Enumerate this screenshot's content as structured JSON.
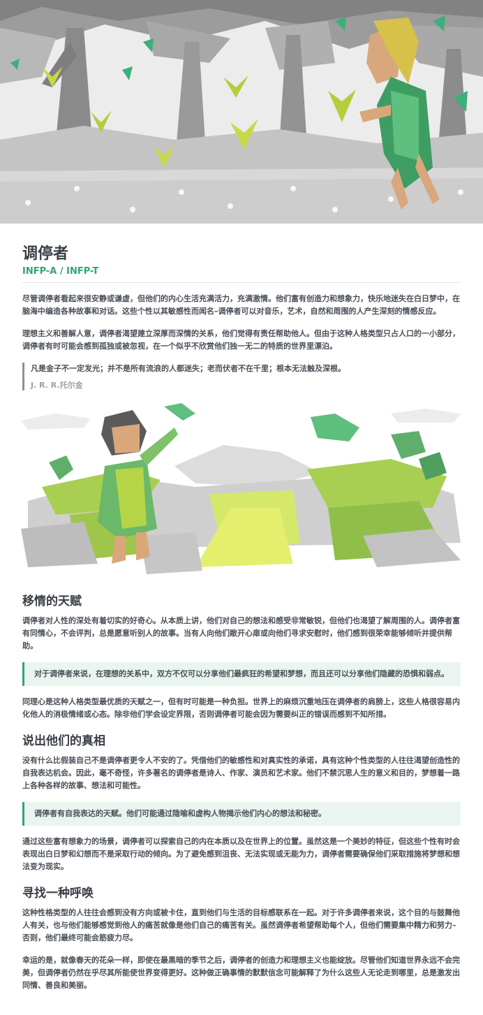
{
  "title": "调停者",
  "subtitle": "INFP-A / INFP-T",
  "intro": [
    "尽管调停者看起来很安静或谦虚，但他们的内心生活充满活力，充满激情。他们富有创造力和想象力，快乐地迷失在白日梦中，在脑海中编造各种故事和对话。这些个性以其敏感性而闻名–调停者可以对音乐，艺术，自然和周围的人产生深刻的情感反应。",
    "理想主义和善解人意，调停者渴望建立深厚而深情的关系，他们觉得有责任帮助他人。但由于这种人格类型只占人口的一小部分，调停者有时可能会感到孤独或被忽视，在一个似乎不欣赏他们独一无二的特质的世界里漂泊。"
  ],
  "quote": {
    "text": "凡是金子不一定发光；并不是所有流浪的人都迷失；老而伏者不在千里；根本无法触及深根。",
    "author": "J. R. R.托尔金"
  },
  "sections": [
    {
      "heading": "移情的天赋",
      "para1": "调停者对人性的深处有着切实的好奇心。从本质上讲，他们对自己的想法和感受非常敏锐，但他们也渴望了解周围的人。调停者富有同情心，不会评判，总是愿意听别人的故事。当有人向他们敞开心扉或向他们寻求安慰时，他们感到很荣幸能够倾听并提供帮助。",
      "callout": "对于调停者来说，在理想的关系中，双方不仅可以分享他们最疯狂的希望和梦想，而且还可以分享他们隐藏的恐惧和弱点。",
      "para2": "同理心是这种人格类型最优质的天赋之一，但有时可能是一种负担。世界上的麻烦沉重地压在调停者的肩膀上，这些人格很容易内化他人的消极情绪或心态。除非他们学会设定界限，否则调停者可能会因为需要纠正的错误而感到不知所措。"
    },
    {
      "heading": "说出他们的真相",
      "para1": "没有什么比假装自己不是调停者更令人不安的了。凭借他们的敏感性和对真实性的承诺，具有这种个性类型的人往往渴望创造性的自我表达机会。因此，毫不奇怪，许多著名的调停者是诗人、作家、演员和艺术家。他们不禁沉思人生的意义和目的，梦想着一路上各种各样的故事、想法和可能性。",
      "callout": "调停者有自我表达的天赋。他们可能通过隐喻和虚构人物揭示他们内心的想法和秘密。",
      "para2": "通过这些富有想象力的场景，调停者可以探索自己的内在本质以及在世界上的位置。虽然这是一个美妙的特征，但这些个性有时会表现出白日梦和幻想而不是采取行动的倾向。为了避免感到沮丧、无法实现或无能为力，调停者需要确保他们采取措施将梦想和想法变为现实。"
    },
    {
      "heading": "寻找一种呼唤",
      "para1": "这种性格类型的人往往会感到没有方向或被卡住，直到他们与生活的目标感联系在一起。对于许多调停者来说，这个目的与鼓舞他人有关，也与他们能够感觉到他人的痛苦就像是他们自己的痛苦有关。虽然调停者希望帮助每个人，但他们需要集中精力和努力–否则，他们最终可能会筋疲力尽。",
      "para2": "幸运的是，就像春天的花朵一样，即使在最黑暗的季节之后，调停者的创造力和理想主义也能绽放。尽管他们知道世界永远不会完美，但调停者仍然在乎尽其所能使世界变得更好。这种做正确事情的默默信念可能解释了为什么这些人无论走到哪里，总是激发出同情、善良和美丽。"
    }
  ],
  "colors": {
    "accent": "#33a474",
    "heading": "#3a3f45",
    "callout_bg": "#eaf5f0"
  }
}
